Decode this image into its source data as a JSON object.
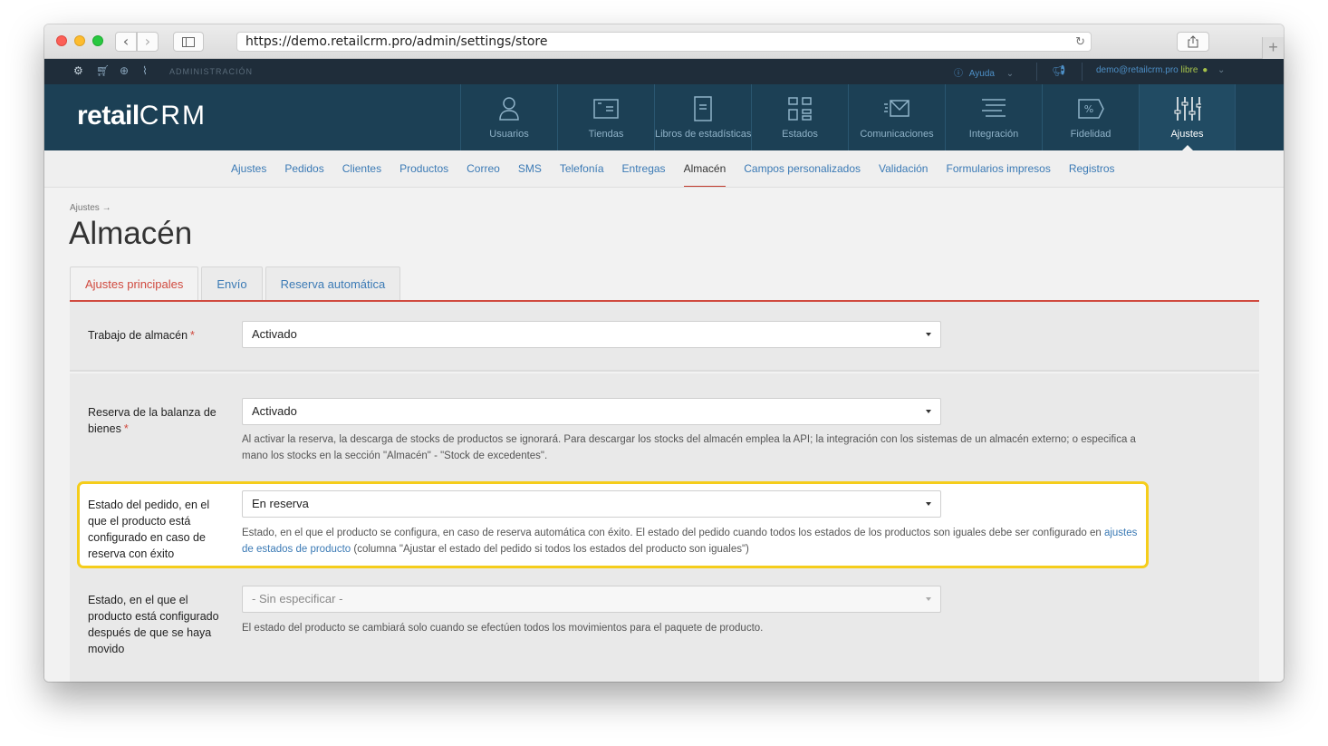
{
  "browser": {
    "url": "https://demo.retailcrm.pro/admin/settings/store"
  },
  "adminbar": {
    "section": "ADMINISTRACIÓN",
    "help": "Ayuda",
    "email": "demo@retailcrm.pro",
    "plan": "libre"
  },
  "header": {
    "logo_retail": "retail",
    "logo_crm": "CRM",
    "modules": [
      {
        "label": "Usuarios",
        "icon": "user-icon"
      },
      {
        "label": "Tiendas",
        "icon": "store-icon"
      },
      {
        "label": "Libros de estadísticas",
        "icon": "book-icon"
      },
      {
        "label": "Estados",
        "icon": "statuses-icon"
      },
      {
        "label": "Comunicaciones",
        "icon": "mail-icon"
      },
      {
        "label": "Integración",
        "icon": "integration-icon"
      },
      {
        "label": "Fidelidad",
        "icon": "loyalty-icon"
      },
      {
        "label": "Ajustes",
        "icon": "settings-sliders-icon"
      }
    ]
  },
  "submenu": [
    "Ajustes",
    "Pedidos",
    "Clientes",
    "Productos",
    "Correo",
    "SMS",
    "Telefonía",
    "Entregas",
    "Almacén",
    "Campos personalizados",
    "Validación",
    "Formularios impresos",
    "Registros"
  ],
  "page": {
    "breadcrumb": "Ajustes →",
    "title": "Almacén",
    "tabs": [
      "Ajustes principales",
      "Envío",
      "Reserva automática"
    ]
  },
  "form": {
    "warehouse_label": "Trabajo de almacén",
    "warehouse_value": "Activado",
    "reserve_label": "Reserva de la balanza de bienes",
    "reserve_value": "Activado",
    "reserve_help": "Al activar la reserva, la descarga de stocks de productos se ignorará. Para descargar los stocks del almacén emplea la API; la integración con los sistemas de un almacén externo; o especifica a mano los stocks en la sección \"Almacén\" - \"Stock de excedentes\".",
    "order_status_label": "Estado del pedido, en el que el producto está configurado en caso de reserva con éxito",
    "order_status_value": "En reserva",
    "order_status_help_1": "Estado, en el que el producto se configura, en caso de reserva automática con éxito. El estado del pedido cuando todos los estados de los productos son iguales debe ser configurado en",
    "order_status_help_link": "ajustes de estados de producto",
    "order_status_help_2": " (columna \"Ajustar el estado del pedido si todos los estados del producto son iguales\")",
    "moved_label": "Estado, en el que el producto está configurado después de que se haya movido",
    "moved_value": "- Sin especificar -",
    "moved_help": "El estado del producto se cambiará solo cuando se efectúen todos los movimientos para el paquete de producto.",
    "required_mark": "*"
  },
  "colors": {
    "header_bg": "#1c4055",
    "accent_red": "#d04a3f",
    "link_blue": "#3b7ab5",
    "highlight": "#f5cd1b"
  }
}
